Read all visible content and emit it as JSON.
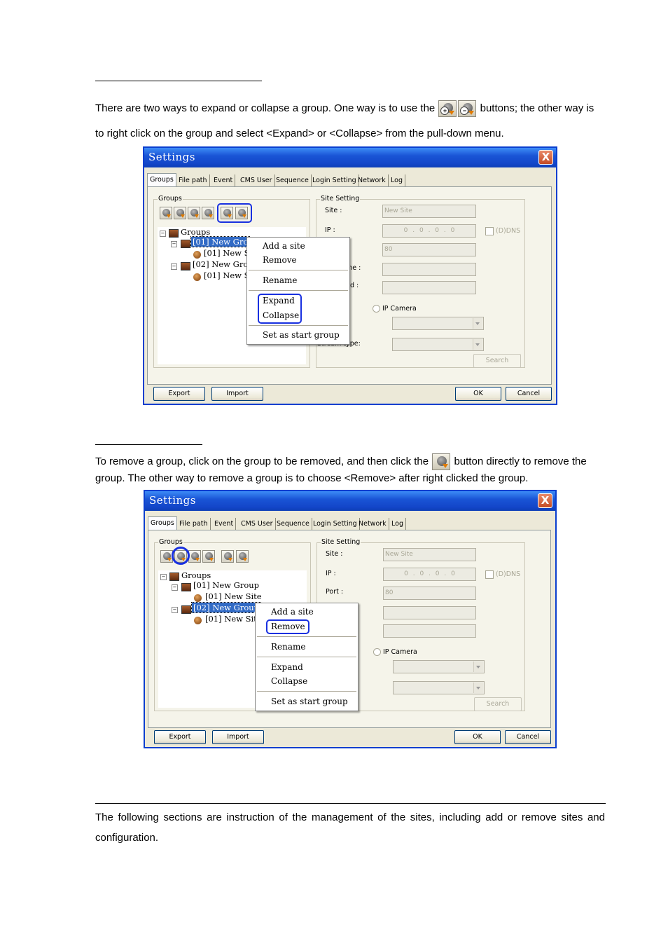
{
  "section1": {
    "para_before_icons": "There are two ways to expand or collapse a group. One way is to use the",
    "para_after_icons": "buttons; the other way is to right click on the group and select <Expand> or <Collapse> from the pull-down menu."
  },
  "section2": {
    "para_before_icon": "To remove a group, click on the group to be removed, and then click the",
    "para_after_icon": "button directly to remove the group. The other way to remove a group is to choose <Remove> after right clicked the group."
  },
  "section3": {
    "para": "The following sections are instruction of the management of the sites, including add or remove sites and configuration."
  },
  "dialog": {
    "title": "Settings",
    "close": "X",
    "tabs": [
      "Groups",
      "File path",
      "Event",
      "CMS User",
      "Sequence",
      "Login Setting",
      "Network",
      "Log"
    ],
    "groups_legend": "Groups",
    "site_legend": "Site Setting",
    "site_label": "Site :",
    "site_placeholder": "New Site",
    "ip_label": "IP :",
    "ip_value": "0 . 0 . 0 . 0",
    "ddns_label": "(D)DNS",
    "port_label": "Port :",
    "port_value": "80",
    "ip_camera_label": "IP Camera",
    "search_button": "Search",
    "export_button": "Export",
    "import_button": "Import",
    "ok_button": "OK",
    "cancel_button": "Cancel"
  },
  "screenshot1": {
    "tree": {
      "root": "Groups",
      "g1": "[01] New Gro",
      "g1s": "[01] New S",
      "g2": "[02] New Gro",
      "g2s": "[01] New S"
    },
    "partial_labels": {
      "name_tail": "me :",
      "pwd_tail": "d :",
      "stream_label": "Stream type:"
    },
    "menu": [
      "Add a site",
      "Remove",
      "Rename",
      "Expand",
      "Collapse",
      "Set as start group"
    ]
  },
  "screenshot2": {
    "tree": {
      "root": "Groups",
      "g1": "[01] New Group",
      "g1s": "[01] New Site",
      "g2": "[02] New Group",
      "g2s": "[01] New Sit"
    },
    "menu": [
      "Add a site",
      "Remove",
      "Rename",
      "Expand",
      "Collapse",
      "Set as start group"
    ]
  }
}
